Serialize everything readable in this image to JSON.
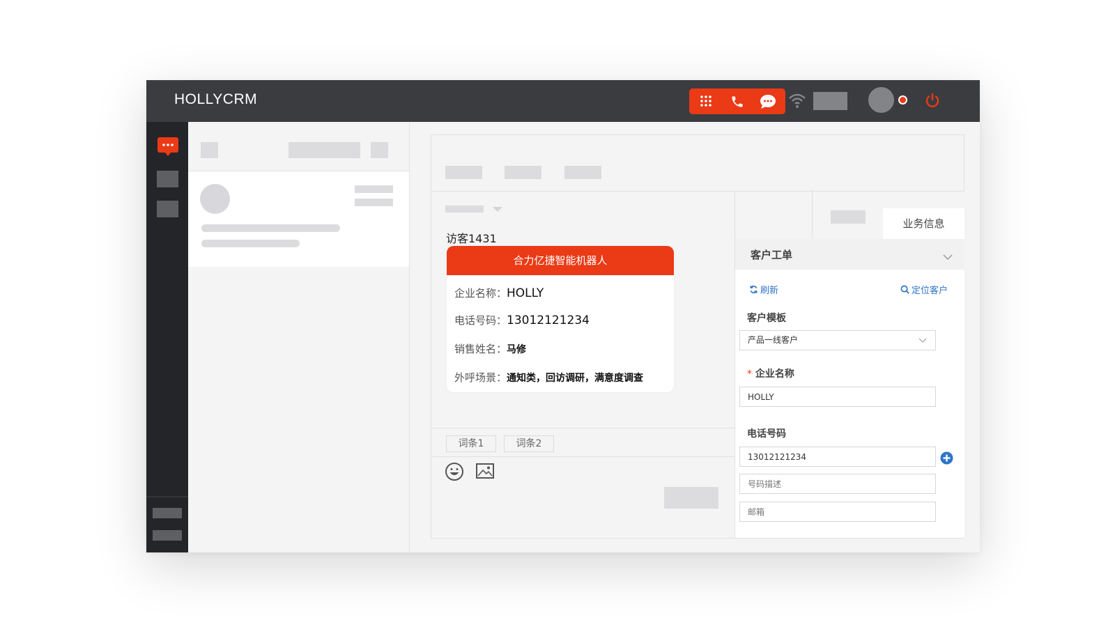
{
  "app": {
    "title": "HOLLYCRM"
  },
  "chat": {
    "visitor_name": "访客1431",
    "bubble": {
      "header": "合力亿捷智能机器人",
      "rows": [
        {
          "label": "企业名称：",
          "value": "HOLLY"
        },
        {
          "label": "电话号码：",
          "value": "13012121234"
        },
        {
          "label": "销售姓名：",
          "value": "马修"
        },
        {
          "label": "外呼场景：",
          "value": "通知类，回访调研，满意度调查"
        }
      ]
    },
    "quick_phrases": [
      "词条1",
      "词条2"
    ]
  },
  "right_panel": {
    "active_tab": "业务信息",
    "section_title": "客户工单",
    "refresh_label": "刷新",
    "locate_label": "定位客户",
    "template_label": "客户模板",
    "template_value": "产品一线客户",
    "required_mark": "*",
    "company_label": "企业名称",
    "company_value": "HOLLY",
    "phone_label": "电话号码",
    "phone_value": "13012121234",
    "phone_desc_placeholder": "号码描述",
    "email_placeholder": "邮箱"
  },
  "colors": {
    "accent": "#ea3a16",
    "topbar": "#3b3c40",
    "sidebar": "#242529",
    "link": "#2e74c8",
    "status_dot": "#ea3a16"
  }
}
